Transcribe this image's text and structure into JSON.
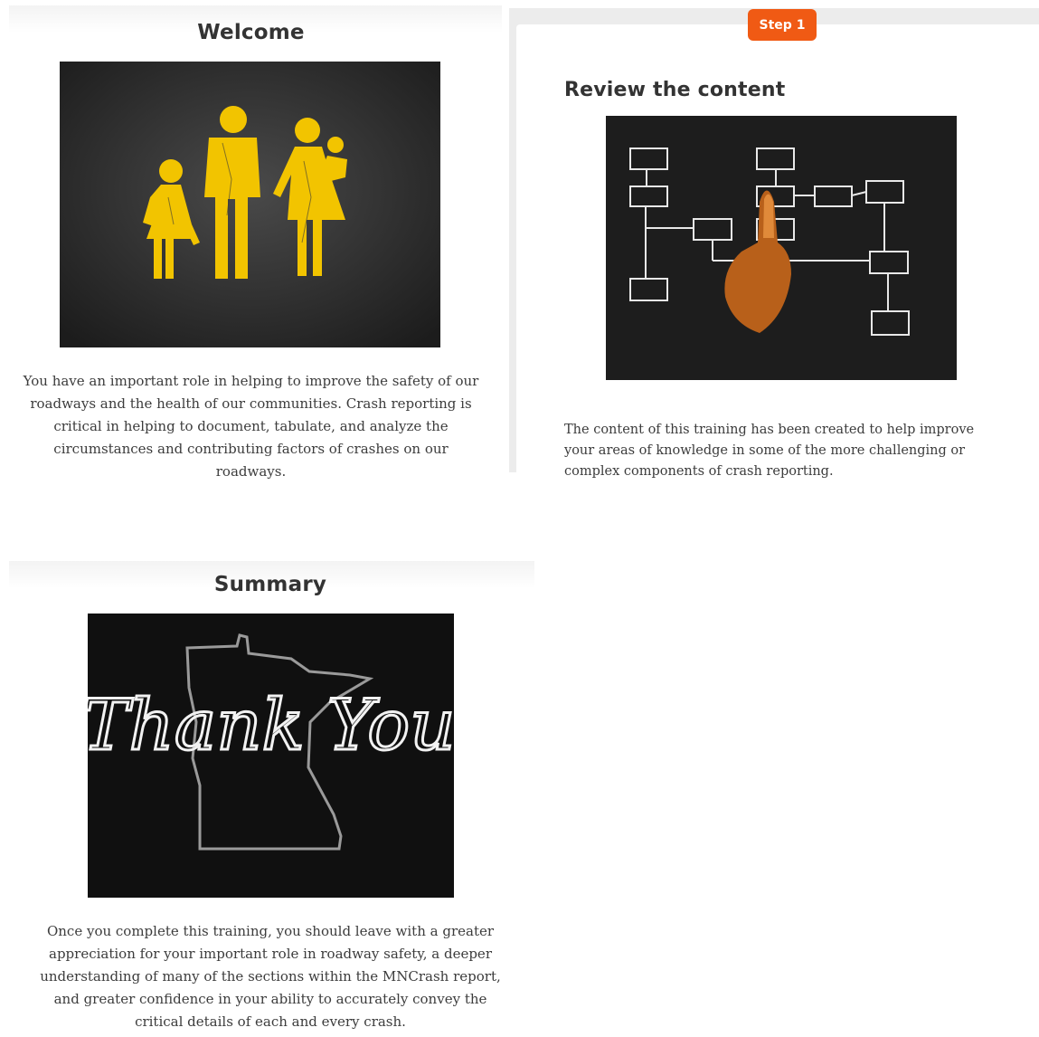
{
  "welcome": {
    "title": "Welcome",
    "image_icon": "family-road-marking-image",
    "text": "You have an important role in helping to improve the safety of our roadways and the health of our communities. Crash reporting is critical in helping to document, tabulate, and analyze the circumstances and contributing factors of crashes on our roadways."
  },
  "step": {
    "badge": "Step 1",
    "title": "Review the content",
    "image_icon": "flowchart-hand-image",
    "text": "The content of this training has been created to help improve your areas of knowledge in some of the more challenging or complex components of crash reporting.",
    "accent_color": "#f05a14"
  },
  "summary": {
    "title": "Summary",
    "image_icon": "thank-you-minnesota-image",
    "image_caption": "Thank You",
    "text": "Once you complete this training, you should leave with a greater appreciation for your important role in roadway safety, a deeper understanding of many of the sections within the MNCrash report, and greater confidence in your ability to accurately convey the critical details of each and every crash."
  }
}
